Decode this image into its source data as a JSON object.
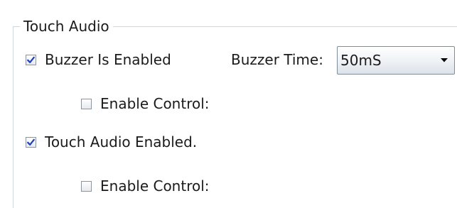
{
  "group": {
    "title": "Touch Audio"
  },
  "buzzer": {
    "enabled_label": "Buzzer Is Enabled",
    "enabled_checked": true,
    "time_label": "Buzzer Time:",
    "time_value": "50mS",
    "enable_control_label": "Enable Control:",
    "enable_control_checked": false
  },
  "touch_audio": {
    "enabled_label": "Touch Audio Enabled.",
    "enabled_checked": true,
    "enable_control_label": "Enable Control:",
    "enable_control_checked": false
  },
  "icons": {
    "checkmark": "checkmark-icon",
    "dropdown": "chevron-down-icon"
  },
  "colors": {
    "check_mark": "#1f3fbf",
    "group_border": "#cfd6de"
  }
}
